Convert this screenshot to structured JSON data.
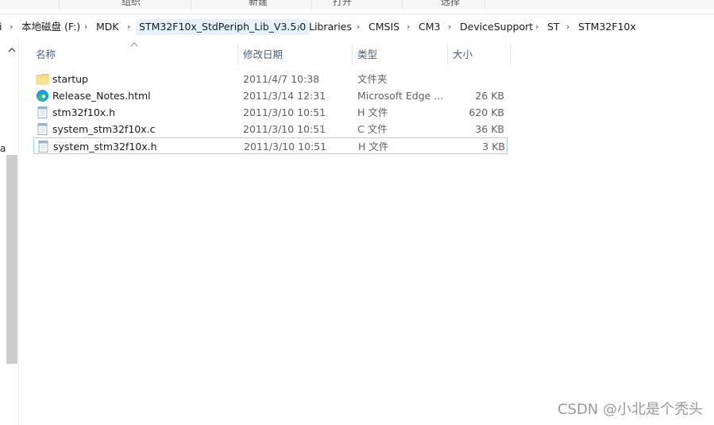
{
  "ribbon": {
    "groups": [
      "组织",
      "新建",
      "打开",
      "选择"
    ]
  },
  "address": {
    "left_fragment": "i",
    "crumbs": [
      "本地磁盘 (F:)",
      "MDK",
      "STM32F10x_StdPeriph_Lib_V3.5.0",
      "Libraries",
      "CMSIS",
      "CM3",
      "DeviceSupport",
      "ST",
      "STM32F10x"
    ]
  },
  "nav": {
    "fragment": "a"
  },
  "columns": {
    "name": "名称",
    "date": "修改日期",
    "type": "类型",
    "size": "大小"
  },
  "files": [
    {
      "name": "startup",
      "date": "2011/4/7 10:38",
      "type": "文件夹",
      "size": "",
      "icon": "folder-icon"
    },
    {
      "name": "Release_Notes.html",
      "date": "2011/3/14 12:31",
      "type": "Microsoft Edge ...",
      "size": "26 KB",
      "icon": "edge-icon"
    },
    {
      "name": "stm32f10x.h",
      "date": "2011/3/10 10:51",
      "type": "H 文件",
      "size": "620 KB",
      "icon": "file-icon"
    },
    {
      "name": "system_stm32f10x.c",
      "date": "2011/3/10 10:51",
      "type": "C 文件",
      "size": "36 KB",
      "icon": "file-icon"
    },
    {
      "name": "system_stm32f10x.h",
      "date": "2011/3/10 10:51",
      "type": "H 文件",
      "size": "3 KB",
      "icon": "file-icon"
    }
  ],
  "watermark": "CSDN @小北是个秃头",
  "colors": {
    "selection_border": "#99d1ff",
    "breadcrumb_highlight": "#e5f1fb",
    "folder_yellow": "#f8d775",
    "header_text": "#4c607a"
  }
}
